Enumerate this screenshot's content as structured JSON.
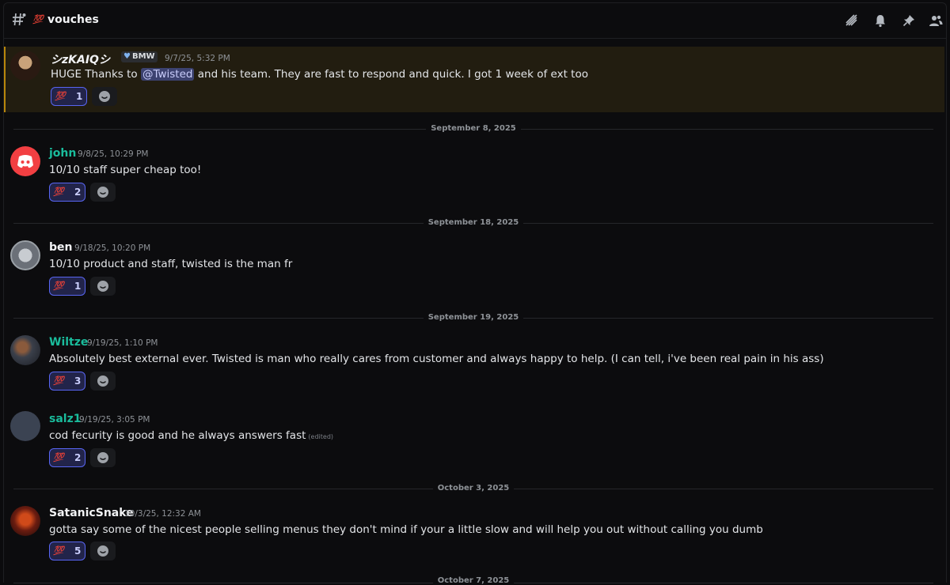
{
  "channel": {
    "emoji": "💯",
    "name": "vouches"
  },
  "header_icons": [
    "threads-icon",
    "bell-icon",
    "pin-icon",
    "members-icon"
  ],
  "colors": {
    "accent": "#5865f2",
    "highlight_border": "#b8860b",
    "teal_name": "#1abc9c"
  },
  "messages": [
    {
      "author": "シzKAIQシ",
      "badge": "BMW",
      "timestamp": "9/7/25, 5:32 PM",
      "text_before": "HUGE Thanks to ",
      "mention": "@Twisted",
      "text_after": " and his team. They are fast to respond and quick. I got 1 week of ext too",
      "reaction_emoji": "💯",
      "reaction_count": "1"
    },
    {
      "author": "john",
      "timestamp": "9/8/25, 10:29 PM",
      "text": "10/10 staff super cheap too!",
      "reaction_emoji": "💯",
      "reaction_count": "2"
    },
    {
      "author": "ben",
      "timestamp": "9/18/25, 10:20 PM",
      "text": "10/10 product and staff, twisted is the man fr",
      "reaction_emoji": "💯",
      "reaction_count": "1"
    },
    {
      "author": "Wiltze",
      "timestamp": "9/19/25, 1:10 PM",
      "text": "Absolutely best external ever. Twisted is man who really cares from customer and always happy to help. (I can tell, i've been real pain in his ass)",
      "reaction_emoji": "💯",
      "reaction_count": "3"
    },
    {
      "author": "salz1",
      "timestamp": "9/19/25, 3:05 PM",
      "text": "cod fecurity is good and he always answers fast",
      "edited": "(edited)",
      "reaction_emoji": "💯",
      "reaction_count": "2"
    },
    {
      "author": "SatanicSnake",
      "timestamp": "10/3/25, 12:32 AM",
      "text": "gotta say some of the nicest people selling menus they don't mind if your a little slow and will help you out without calling you dumb",
      "reaction_emoji": "💯",
      "reaction_count": "5"
    }
  ],
  "dividers": [
    "September 8, 2025",
    "September 18, 2025",
    "September 19, 2025",
    "October 3, 2025",
    "October 7, 2025"
  ]
}
